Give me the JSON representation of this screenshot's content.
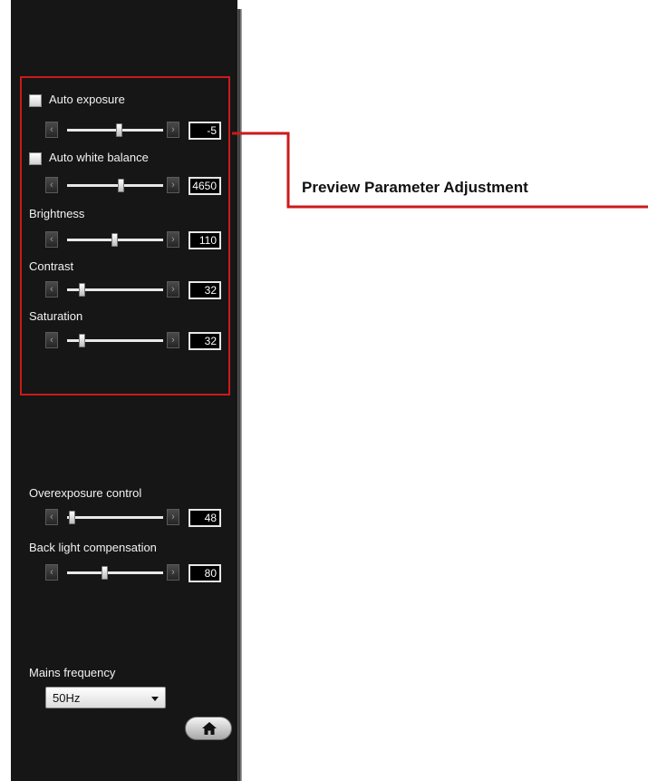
{
  "annotation": {
    "label": "Preview Parameter Adjustment",
    "color": "#cc1a1a"
  },
  "preview_params": {
    "auto_exposure": {
      "label": "Auto exposure",
      "checked": false,
      "value": "-5",
      "level": 0.55
    },
    "auto_white_balance": {
      "label": "Auto white balance",
      "checked": false,
      "value": "4650",
      "level": 0.57
    },
    "brightness": {
      "label": "Brightness",
      "value": "110",
      "level": 0.49
    },
    "contrast": {
      "label": "Contrast",
      "value": "32",
      "level": 0.13
    },
    "saturation": {
      "label": "Saturation",
      "value": "32",
      "level": 0.13
    }
  },
  "advanced": {
    "overexposure": {
      "label": "Overexposure control",
      "value": "48",
      "level": 0.02
    },
    "backlight": {
      "label": "Back light compensation",
      "value": "80",
      "level": 0.38
    }
  },
  "mains": {
    "label": "Mains frequency",
    "selected": "50Hz"
  },
  "icons": {
    "left_arrow": "‹",
    "right_arrow": "›",
    "home": "home-icon"
  }
}
